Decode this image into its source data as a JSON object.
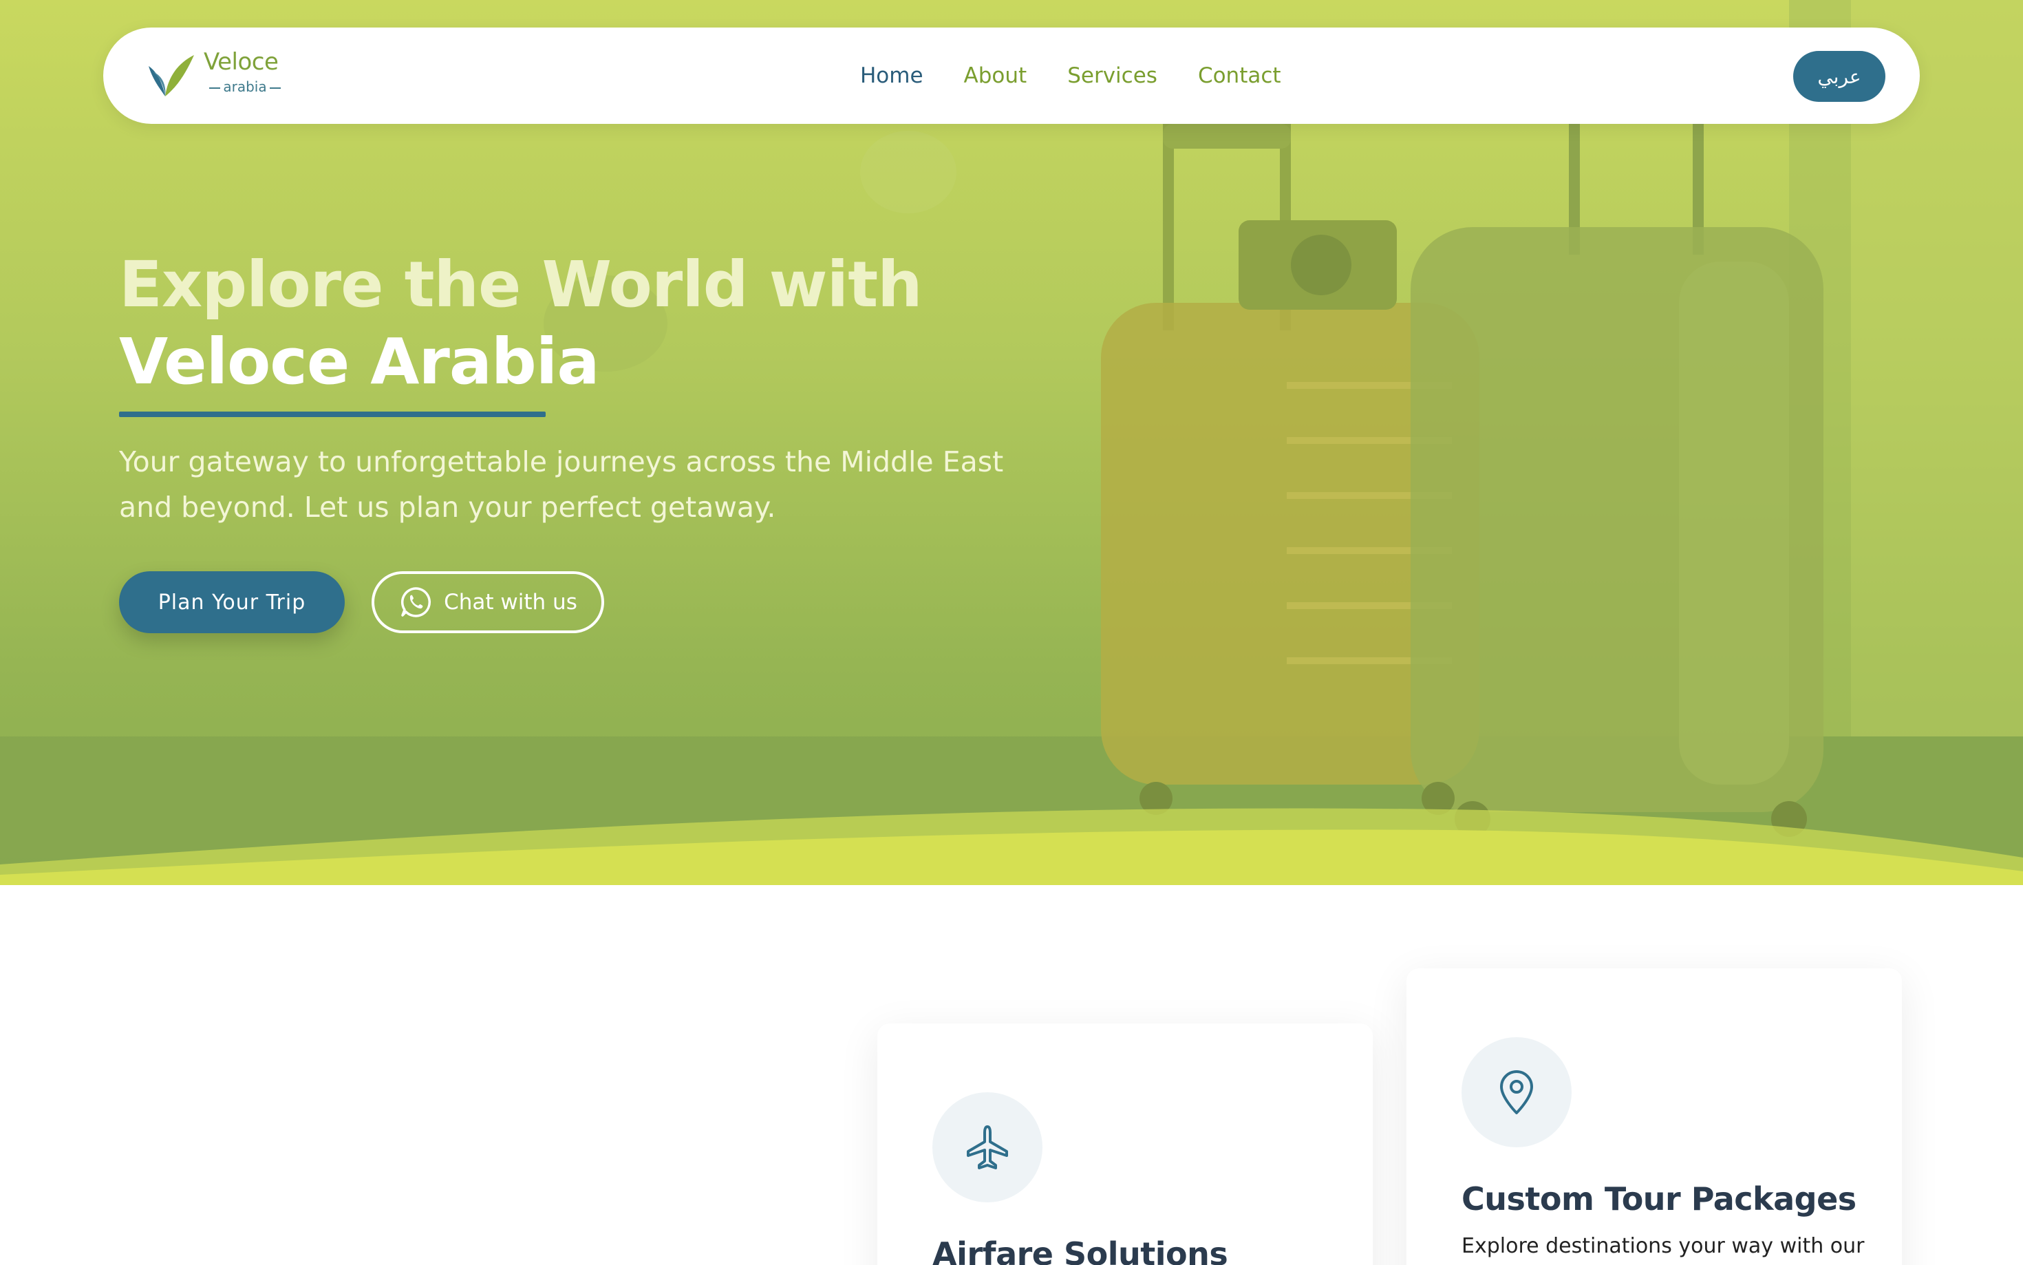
{
  "brand": {
    "name": "Veloce",
    "sub": "arabia",
    "colors": {
      "primary": "#2f6f8c",
      "green": "#7fa23a",
      "lime": "#d3df52"
    }
  },
  "nav": {
    "links": [
      {
        "label": "Home",
        "active": true
      },
      {
        "label": "About"
      },
      {
        "label": "Services"
      },
      {
        "label": "Contact"
      }
    ],
    "lang_button": "عربي"
  },
  "hero": {
    "title_line1": "Explore the World with",
    "title_line2": "Veloce Arabia",
    "subtitle": "Your gateway to unforgettable journeys across the Middle East and beyond. Let us plan your perfect getaway.",
    "primary_cta": "Plan Your Trip",
    "secondary_cta": "Chat with us",
    "secondary_icon": "whatsapp-icon"
  },
  "cards": [
    {
      "icon": "airplane-icon",
      "title": "Airfare Solutions",
      "text": ""
    },
    {
      "icon": "map-pin-icon",
      "title": "Custom Tour Packages",
      "text": "Explore destinations your way with our"
    }
  ]
}
